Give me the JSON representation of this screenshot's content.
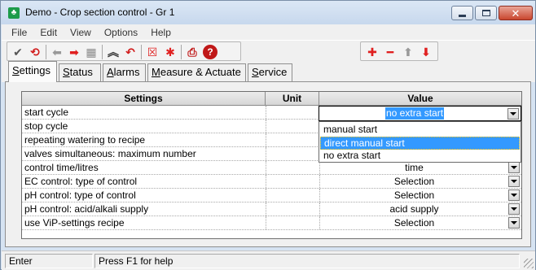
{
  "window": {
    "title": "Demo - Crop section control - Gr 1",
    "app_icon": "app-leaf-icon",
    "controls": {
      "minimize": "minimize-icon",
      "maximize": "maximize-icon",
      "close": "close-icon"
    }
  },
  "menu": {
    "items": [
      {
        "label": "File"
      },
      {
        "label": "Edit"
      },
      {
        "label": "View"
      },
      {
        "label": "Options"
      },
      {
        "label": "Help"
      }
    ]
  },
  "toolbar": {
    "group1": [
      {
        "icon": "checkmark-icon",
        "glyph": "✔",
        "color": "#555555"
      },
      {
        "icon": "refresh-icon",
        "glyph": "⟲",
        "color": "#d11a1a"
      },
      {
        "icon": "arrow-left-icon",
        "glyph": "⬅",
        "color": "#999999"
      },
      {
        "icon": "arrow-right-icon",
        "glyph": "➡",
        "color": "#e02020"
      },
      {
        "icon": "table-icon",
        "glyph": "▦",
        "color": "#8a8a8a"
      },
      {
        "icon": "collapse-up-icon",
        "glyph": "︽",
        "color": "#333333"
      },
      {
        "icon": "undo-icon",
        "glyph": "↶",
        "color": "#d11a1a"
      },
      {
        "icon": "delete-box-icon",
        "glyph": "☒",
        "color": "#e02020"
      },
      {
        "icon": "asterisk-icon",
        "glyph": "✱",
        "color": "#e02020"
      },
      {
        "icon": "printer-icon",
        "glyph": "⎙",
        "color": "#c01818"
      },
      {
        "icon": "help-icon",
        "glyph": "?",
        "color": "#ffffff"
      }
    ],
    "group2": [
      {
        "icon": "plus-icon",
        "glyph": "✚",
        "color": "#e02020"
      },
      {
        "icon": "minus-icon",
        "glyph": "━",
        "color": "#e02020"
      },
      {
        "icon": "arrow-up-icon",
        "glyph": "⬆",
        "color": "#999999"
      },
      {
        "icon": "arrow-down-icon",
        "glyph": "⬇",
        "color": "#e02020"
      }
    ]
  },
  "tabs": [
    {
      "label_u": "S",
      "label_rest": "ettings",
      "active": true
    },
    {
      "label_u": "S",
      "label_rest": "tatus",
      "pre": "",
      "active": false
    },
    {
      "label_u": "A",
      "label_rest": "larms",
      "active": false
    },
    {
      "label_u": "M",
      "label_rest": "easure & Actuate",
      "active": false
    },
    {
      "label_u": "S",
      "label_rest": "ervice",
      "active": false
    }
  ],
  "grid": {
    "headers": {
      "settings": "Settings",
      "unit": "Unit",
      "value": "Value"
    },
    "rows": [
      {
        "setting": "start cycle",
        "unit": "",
        "value": "no extra start",
        "dropdown": true,
        "editing": true
      },
      {
        "setting": "stop cycle",
        "unit": "",
        "value": "",
        "dropdown": false
      },
      {
        "setting": "repeating watering to recipe",
        "unit": "",
        "value": "",
        "dropdown": false
      },
      {
        "setting": "valves simultaneous: maximum number",
        "unit": "",
        "value": "",
        "dropdown": false
      },
      {
        "setting": "control time/litres",
        "unit": "",
        "value": "time",
        "dropdown": true
      },
      {
        "setting": "EC control: type of control",
        "unit": "",
        "value": "Selection",
        "dropdown": true
      },
      {
        "setting": "pH control: type of control",
        "unit": "",
        "value": "Selection",
        "dropdown": true
      },
      {
        "setting": "pH control: acid/alkali supply",
        "unit": "",
        "value": "acid supply",
        "dropdown": true
      },
      {
        "setting": "use ViP-settings recipe",
        "unit": "",
        "value": "Selection",
        "dropdown": true
      }
    ],
    "dropdown_options": [
      {
        "label": "manual start",
        "selected": false
      },
      {
        "label": "direct manual start",
        "selected": true
      },
      {
        "label": "no extra start",
        "selected": false
      }
    ]
  },
  "status": {
    "mode": "Enter",
    "help": "Press F1 for help"
  },
  "colors": {
    "selection": "#3399ff",
    "focus_border": "#f8c000"
  }
}
